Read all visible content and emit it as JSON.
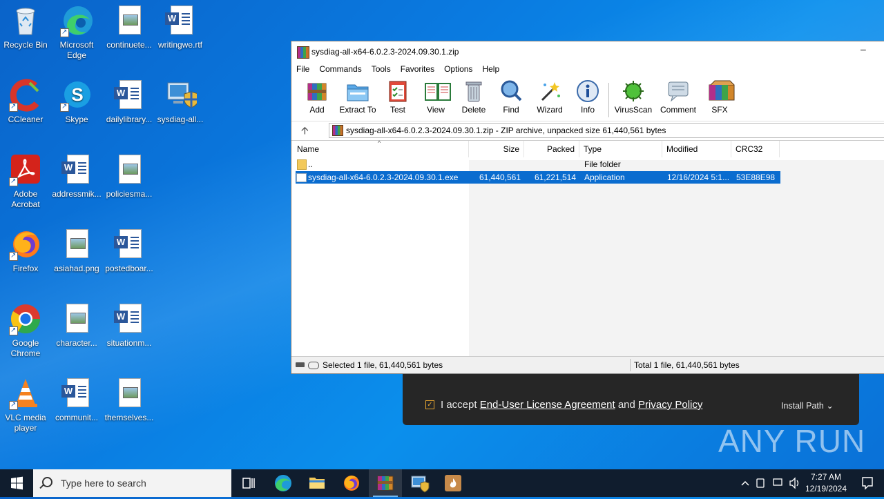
{
  "desktop": {
    "icons": [
      {
        "label": "Recycle Bin"
      },
      {
        "label": "Microsoft Edge"
      },
      {
        "label": "continuete..."
      },
      {
        "label": "writingwe.rtf"
      },
      {
        "label": "CCleaner"
      },
      {
        "label": "Skype"
      },
      {
        "label": "dailylibrary..."
      },
      {
        "label": "sysdiag-all..."
      },
      {
        "label": "Adobe Acrobat"
      },
      {
        "label": "addressmik..."
      },
      {
        "label": "policiesma..."
      },
      {
        "label": "Firefox"
      },
      {
        "label": "asiahad.png"
      },
      {
        "label": "postedboar..."
      },
      {
        "label": "Google Chrome"
      },
      {
        "label": "character..."
      },
      {
        "label": "situationm..."
      },
      {
        "label": "VLC media player"
      },
      {
        "label": "communit..."
      },
      {
        "label": "themselves..."
      }
    ]
  },
  "winrar": {
    "title": "sysdiag-all-x64-6.0.2.3-2024.09.30.1.zip",
    "menu": [
      "File",
      "Commands",
      "Tools",
      "Favorites",
      "Options",
      "Help"
    ],
    "toolbar": [
      "Add",
      "Extract To",
      "Test",
      "View",
      "Delete",
      "Find",
      "Wizard",
      "Info",
      "VirusScan",
      "Comment",
      "SFX"
    ],
    "path_text": "sysdiag-all-x64-6.0.2.3-2024.09.30.1.zip - ZIP archive, unpacked size 61,440,561 bytes",
    "columns": [
      "Name",
      "Size",
      "Packed",
      "Type",
      "Modified",
      "CRC32"
    ],
    "rows": [
      {
        "name": "..",
        "size": "",
        "packed": "",
        "type": "File folder",
        "modified": "",
        "crc": ""
      },
      {
        "name": "sysdiag-all-x64-6.0.2.3-2024.09.30.1.exe",
        "size": "61,440,561",
        "packed": "61,221,514",
        "type": "Application",
        "modified": "12/16/2024 5:1...",
        "crc": "53E88E98"
      }
    ],
    "status_left": "Selected 1 file, 61,440,561 bytes",
    "status_right": "Total 1 file, 61,440,561 bytes"
  },
  "installer": {
    "accept_prefix": "I accept",
    "eula_link": "End-User License Agreement",
    "and_text": "and",
    "privacy_link": "Privacy Policy",
    "install_path": "Install Path"
  },
  "watermark": "ANY RUN",
  "taskbar": {
    "search_placeholder": "Type here to search",
    "time": "7:27 AM",
    "date": "12/19/2024"
  },
  "colors": {
    "selection": "#0a6ccf",
    "taskbar": "#101d2e",
    "installer_bg": "#262626",
    "checkbox": "#e8a630"
  }
}
